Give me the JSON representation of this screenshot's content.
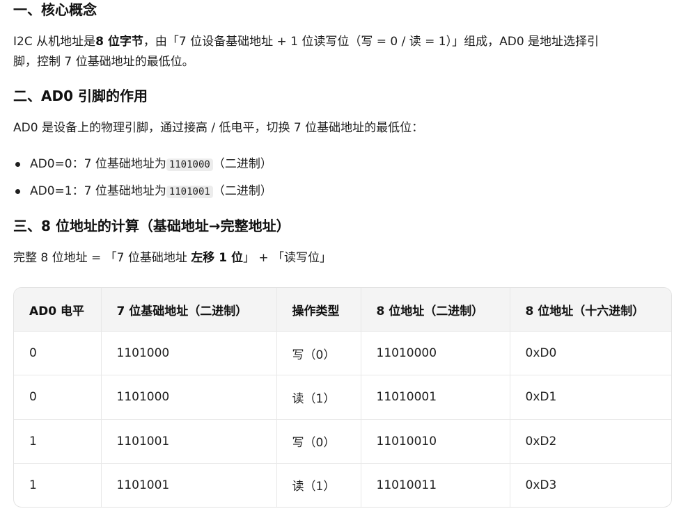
{
  "sections": [
    {
      "heading": "一、核心概念",
      "paragraph": {
        "prefix": "I2C 从机地址是",
        "strong": "8 位字节",
        "mid": "，由「7 位设备基础地址 + 1 位读写位（写 = 0 / 读 = 1）」组成，AD0 是地址选择引",
        "tail": "脚，控制 7 位基础地址的最低位。"
      }
    },
    {
      "heading": "二、AD0 引脚的作用",
      "paragraph": "AD0 是设备上的物理引脚，通过接高 / 低电平，切换 7 位基础地址的最低位：",
      "bullets": [
        {
          "prefix": "AD0=0：7 位基础地址为",
          "code": "1101000",
          "suffix": "（二进制）"
        },
        {
          "prefix": "AD0=1：7 位基础地址为",
          "code": "1101001",
          "suffix": "（二进制）"
        }
      ]
    },
    {
      "heading": "三、8 位地址的计算（基础地址→完整地址）",
      "formula": {
        "prefix": "完整 8 位地址 = 「7 位基础地址 ",
        "strong": "左移 1 位",
        "suffix": "」 + 「读写位」"
      }
    }
  ],
  "table": {
    "headers": [
      "AD0 电平",
      "7 位基础地址（二进制）",
      "操作类型",
      "8 位地址（二进制）",
      "8 位地址（十六进制）"
    ],
    "rows": [
      [
        "0",
        "1101000",
        "写（0）",
        "11010000",
        "0xD0"
      ],
      [
        "0",
        "1101000",
        "读（1）",
        "11010001",
        "0xD1"
      ],
      [
        "1",
        "1101001",
        "写（0）",
        "11010010",
        "0xD2"
      ],
      [
        "1",
        "1101001",
        "读（1）",
        "11010011",
        "0xD3"
      ]
    ]
  }
}
